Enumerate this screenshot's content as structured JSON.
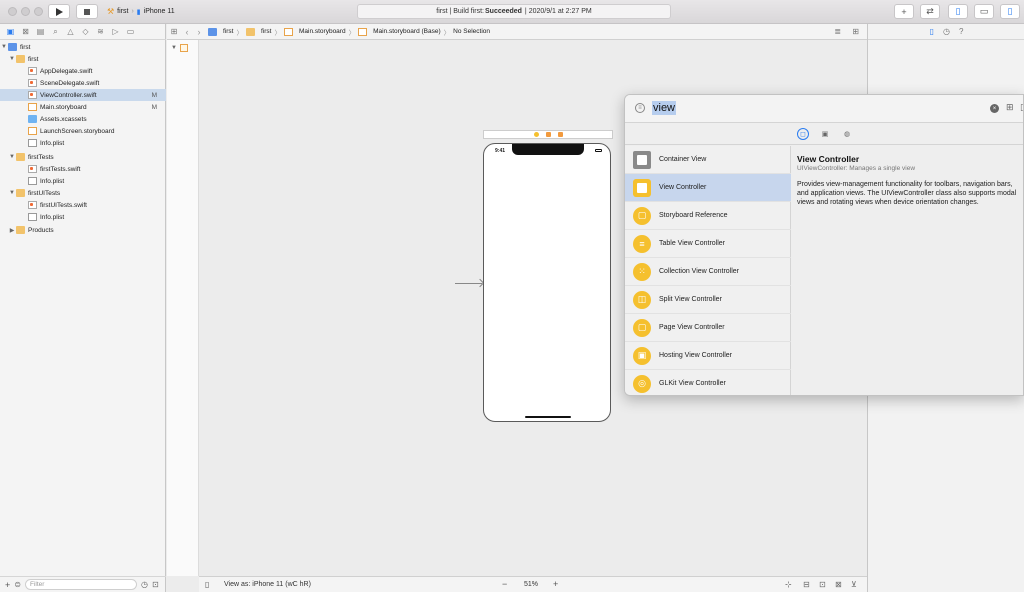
{
  "toolbar": {
    "scheme_target": "first",
    "scheme_device": "iPhone 11",
    "activity_project": "first",
    "activity_prefix": "Build first:",
    "activity_status": "Succeeded",
    "activity_time": "2020/9/1 at 2:27 PM"
  },
  "navigator": {
    "items": [
      {
        "label": "first",
        "badge": ""
      },
      {
        "label": "first",
        "badge": ""
      },
      {
        "label": "AppDelegate.swift",
        "badge": ""
      },
      {
        "label": "SceneDelegate.swift",
        "badge": ""
      },
      {
        "label": "ViewController.swift",
        "badge": "M"
      },
      {
        "label": "Main.storyboard",
        "badge": "M"
      },
      {
        "label": "Assets.xcassets",
        "badge": ""
      },
      {
        "label": "LaunchScreen.storyboard",
        "badge": ""
      },
      {
        "label": "Info.plist",
        "badge": ""
      },
      {
        "label": "firstTests",
        "badge": ""
      },
      {
        "label": "firstTests.swift",
        "badge": ""
      },
      {
        "label": "Info.plist",
        "badge": ""
      },
      {
        "label": "firstUITests",
        "badge": ""
      },
      {
        "label": "firstUITests.swift",
        "badge": ""
      },
      {
        "label": "Info.plist",
        "badge": ""
      },
      {
        "label": "Products",
        "badge": ""
      }
    ],
    "filter_placeholder": "Filter"
  },
  "jumpbar": {
    "crumbs": [
      "first",
      "first",
      "Main.storyboard",
      "Main.storyboard (Base)",
      "No Selection"
    ]
  },
  "canvas": {
    "phone_time": "9:41"
  },
  "editor_bottom": {
    "view_as": "View as: iPhone 11 (",
    "view_as_suffix": "wC hR)",
    "zoom_minus": "−",
    "zoom": "51%",
    "zoom_plus": "+"
  },
  "library": {
    "search_value": "view",
    "items": [
      {
        "label": "Container View"
      },
      {
        "label": "View Controller"
      },
      {
        "label": "Storyboard Reference"
      },
      {
        "label": "Table View Controller"
      },
      {
        "label": "Collection View Controller"
      },
      {
        "label": "Split View Controller"
      },
      {
        "label": "Page View Controller"
      },
      {
        "label": "Hosting View Controller"
      },
      {
        "label": "GLKit View Controller"
      }
    ],
    "detail": {
      "title": "View Controller",
      "subtitle": "UIViewController: Manages a single view",
      "description": "Provides view-management functionality for toolbars, navigation bars, and application views. The UIViewController class also supports modal views and rotating views when device orientation changes."
    }
  },
  "colors": {
    "accent": "#2a7cf0",
    "selection": "#c9d9ec",
    "folder": "#f2c36b",
    "library_icon": "#f5c02e"
  }
}
